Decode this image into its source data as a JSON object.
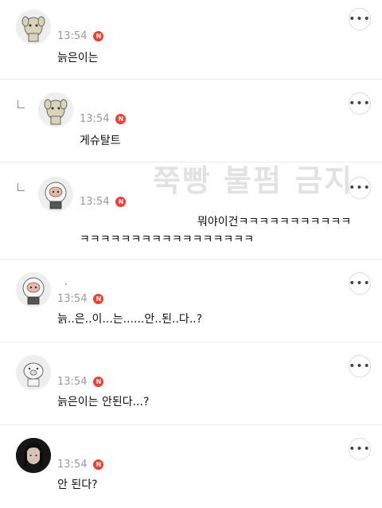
{
  "watermark": "쭉빵 불펌 금지",
  "badge_label": "N",
  "more_label": "•••",
  "comments": [
    {
      "time": "13:54",
      "text": "늙은이는",
      "avatar_icon": "dog-character-icon"
    },
    {
      "time": "13:54",
      "text": "게슈탈트",
      "avatar_icon": "dog-character-icon"
    },
    {
      "time": "13:54",
      "text_line1": "뭐야이건ㅋㅋㅋㅋㅋㅋㅋㅋㅋㅋㅋ",
      "text_line2": "ㅋㅋㅋㅋㅋㅋㅋㅋㅋㅋㅋㅋㅋㅋㅋㅋㅋ",
      "avatar_icon": "astronaut-character-icon"
    },
    {
      "time": "13:54",
      "text": "늙..은..이...는......안..된..다..?",
      "avatar_icon": "astronaut-character-icon"
    },
    {
      "time": "13:54",
      "text": "늙은이는 안된다...?",
      "avatar_icon": "pig-character-icon"
    },
    {
      "time": "13:54",
      "text": "안 된다?",
      "avatar_icon": "person-photo-avatar"
    }
  ]
}
